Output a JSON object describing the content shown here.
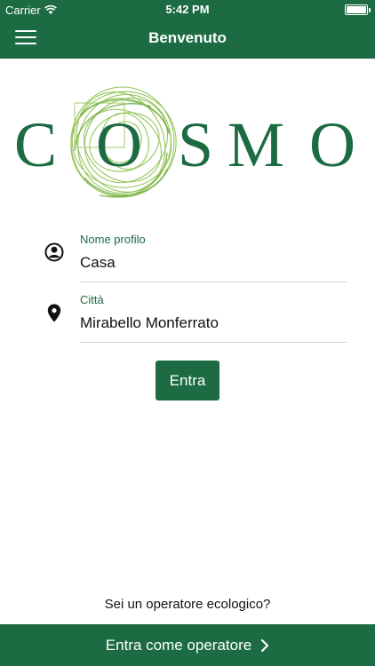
{
  "status_bar": {
    "carrier": "Carrier",
    "time": "5:42 PM"
  },
  "nav": {
    "title": "Benvenuto",
    "menu_icon": "hamburger-icon"
  },
  "logo": {
    "text": "COSMO",
    "brand_color": "#1c6b43",
    "swirl_color": "#8cc04b"
  },
  "form": {
    "profile": {
      "label": "Nome profilo",
      "value": "Casa",
      "icon": "user-icon"
    },
    "city": {
      "label": "Città",
      "value": "Mirabello Monferrato",
      "icon": "location-pin-icon"
    },
    "submit_label": "Entra"
  },
  "footer": {
    "question": "Sei un operatore ecologico?",
    "operator_button": "Entra come operatore",
    "operator_icon": "chevron-right-icon"
  }
}
